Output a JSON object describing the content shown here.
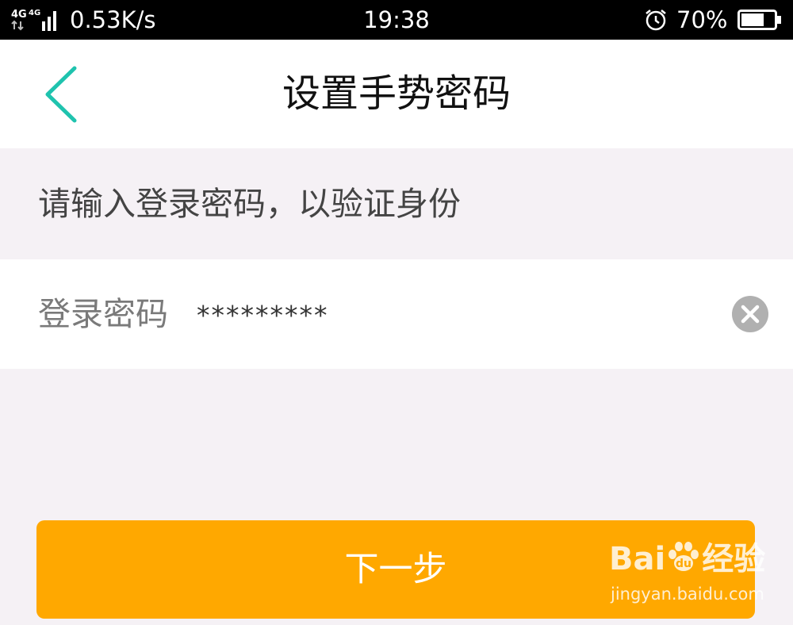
{
  "status_bar": {
    "network": "4G 4G",
    "speed": "0.53K/s",
    "time": "19:38",
    "battery_percent": "70%",
    "battery_level": 0.7,
    "icons": [
      "network-4g-signal-icon",
      "alarm-icon",
      "battery-icon"
    ]
  },
  "header": {
    "title": "设置手势密码",
    "back_icon": "chevron-left-icon",
    "accent_color": "#1fc3ae"
  },
  "prompt": {
    "text": "请输入登录密码，以验证身份"
  },
  "password_field": {
    "label": "登录密码",
    "value": "*********",
    "clear_icon": "clear-circle-icon"
  },
  "next_button": {
    "label": "下一步",
    "color": "#ffa800"
  },
  "watermark": {
    "brand": "Bai",
    "brand_suffix": "经验",
    "url": "jingyan.baidu.com"
  }
}
